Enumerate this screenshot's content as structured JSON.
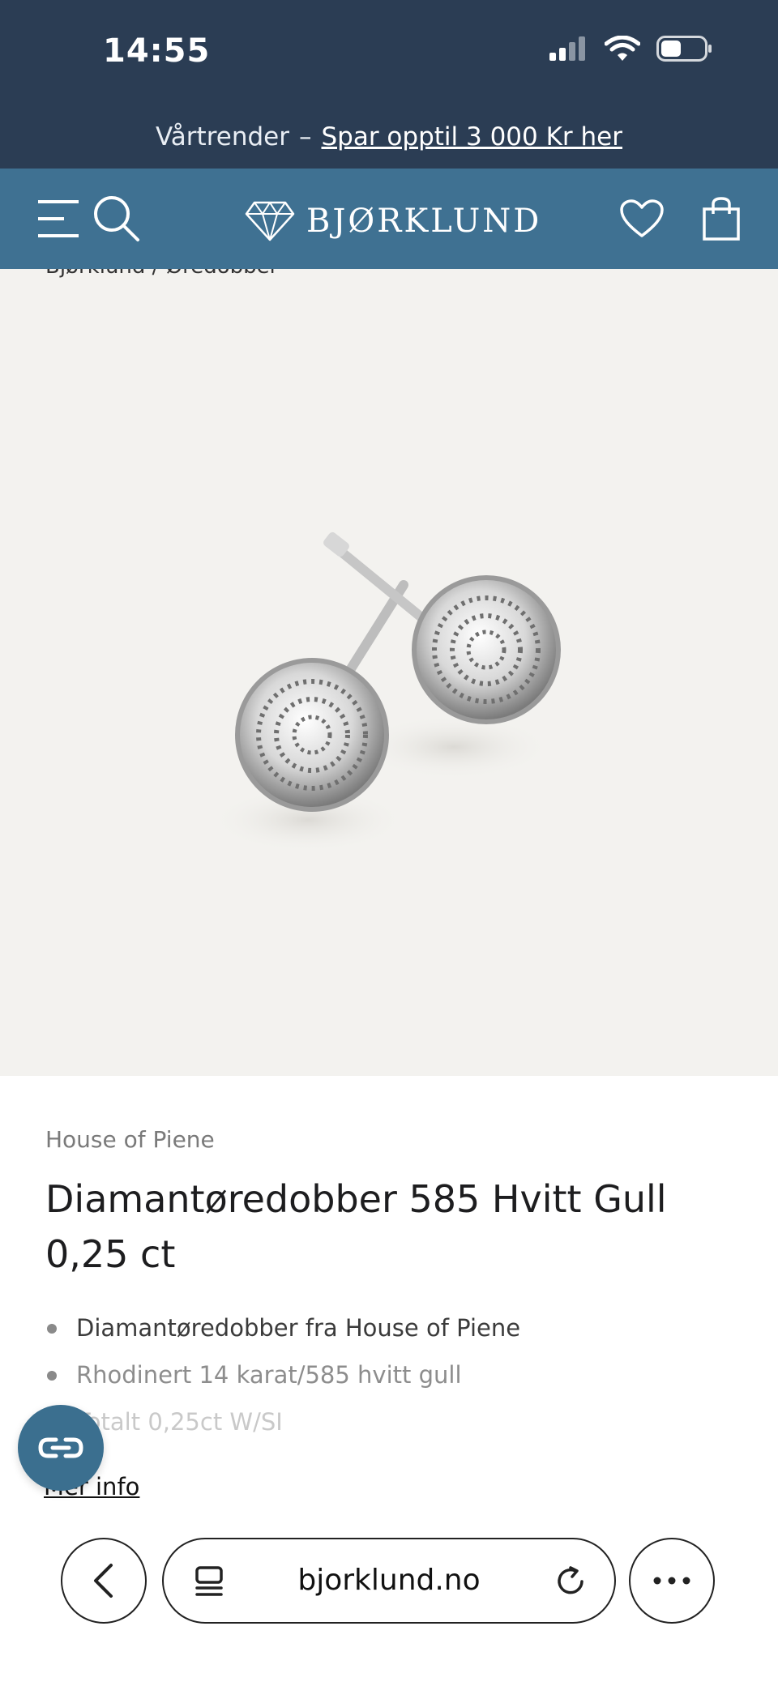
{
  "status": {
    "time": "14:55"
  },
  "promo": {
    "text": "Vårtrender",
    "dash": "–",
    "link": "Spar opptil 3 000 Kr her"
  },
  "header": {
    "logo": "BJØRKLUND"
  },
  "hero": {
    "breadcrumb": "Bjørklund / Øredobber"
  },
  "product": {
    "brand": "House of Piene",
    "title": "Diamantøredobber 585 Hvitt Gull 0,25 ct",
    "bullets": [
      "Diamantøredobber fra House of Piene",
      "Rhodinert 14 karat/585 hvitt gull",
      "Totalt 0,25ct W/SI"
    ],
    "more_link": "Mer info"
  },
  "browser": {
    "url": "bjorklund.no"
  },
  "colors": {
    "status_bg": "#2b3d54",
    "header_bg": "#3f7192",
    "hero_bg": "#f3f2ef",
    "chat_bg": "#3b6f8f"
  }
}
